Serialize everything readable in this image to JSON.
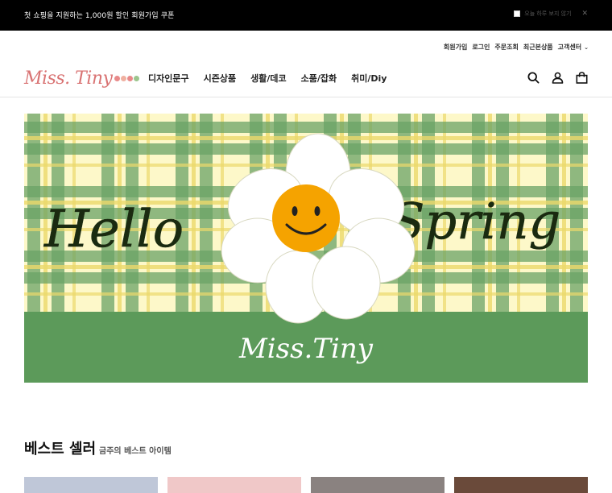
{
  "promo": {
    "text": "첫 쇼핑을 지원하는 1,000원 할인 회원가입 쿠폰",
    "hide_today_label": "오늘 하루 보지 않기",
    "close_glyph": "✕"
  },
  "util_links": [
    "회원가입",
    "로그인",
    "주문조회",
    "최근본상품",
    "고객센터"
  ],
  "util_chevron": "⌄",
  "logo": {
    "text": "Miss. Tiny"
  },
  "nav": [
    "디자인문구",
    "시즌상품",
    "생활/데코",
    "소품/잡화",
    "취미/Diy"
  ],
  "icons": {
    "search": "search-icon",
    "account": "user-icon",
    "cart": "shopping-bag-icon"
  },
  "banner": {
    "left_script": "Hello",
    "right_script": "Spring",
    "brand": "Miss.Tiny",
    "colors": {
      "cream": "#fdf8c9",
      "green": "#5c9a5a",
      "yellow": "#ebd86b",
      "plaid_green": "#6aa365"
    }
  },
  "best": {
    "title": "베스트 셀러",
    "subtitle": "금주의 베스트 아이템"
  },
  "thumb_colors": [
    "#bfc7d8",
    "#f0c8c8",
    "#8a8280",
    "#6a4a3a"
  ]
}
